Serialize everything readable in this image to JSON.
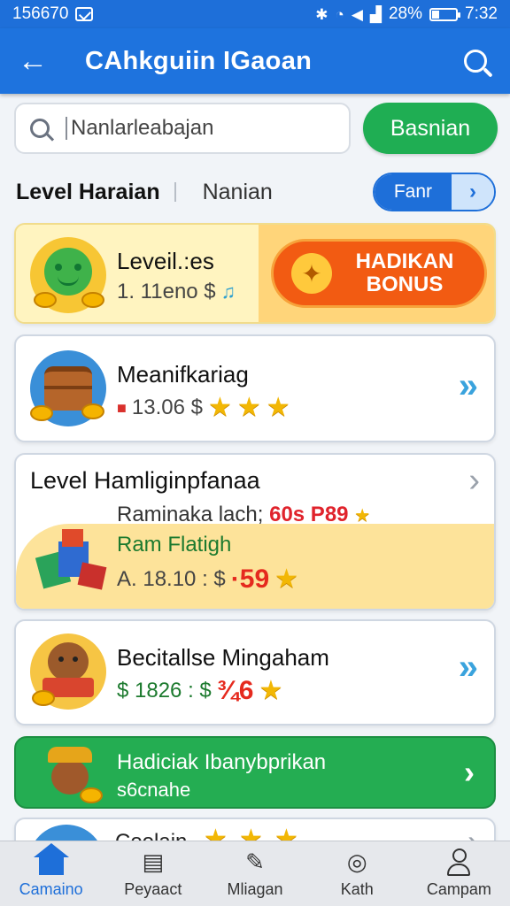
{
  "status_bar": {
    "left_text": "156670",
    "battery": "28%",
    "time": "7:32",
    "battery_level": 0.28
  },
  "app_bar": {
    "back_icon": "back-arrow-icon",
    "title": "CAhkguiin IGaoan",
    "search_icon": "search-icon"
  },
  "search": {
    "placeholder": "Nanlarleabajan",
    "button_label": "Basnian"
  },
  "tabs": {
    "active": "Level Haraian",
    "other": "Nanian",
    "filter_label": "Fanr",
    "filter_arrow": "›"
  },
  "cards": [
    {
      "title": "Leveil.:es",
      "price": "1. 11eno $",
      "bonus_label": "HADIKAN BONUS"
    },
    {
      "title": "Meanifkariag",
      "price": "13.06 $",
      "stars": 3
    },
    {
      "title": "Level Hamliginpfanaa",
      "sub_text": "Raminaka lach;",
      "sub_red": "60s P89",
      "sub_green": "Ram Flatigh",
      "price": "A. 18.10 : $",
      "price_red": "·59"
    },
    {
      "title": "Becitallse Mingaham",
      "price": "$ 1826 : $",
      "price_red": "¾6"
    },
    {
      "title": "Hadiciak Ibanybprikan",
      "subtitle": "s6cnahe"
    },
    {
      "title": "Coolain"
    }
  ],
  "bottom_nav": [
    {
      "label": "Camaino",
      "icon": "home-icon"
    },
    {
      "label": "Peyaact",
      "icon": "list-icon"
    },
    {
      "label": "Mliagan",
      "icon": "edit-icon"
    },
    {
      "label": "Kath",
      "icon": "target-icon"
    },
    {
      "label": "Campam",
      "icon": "person-icon"
    }
  ],
  "colors": {
    "primary": "#1e73de",
    "green": "#24ad52",
    "orange": "#f25b12",
    "star": "#f2b705"
  }
}
